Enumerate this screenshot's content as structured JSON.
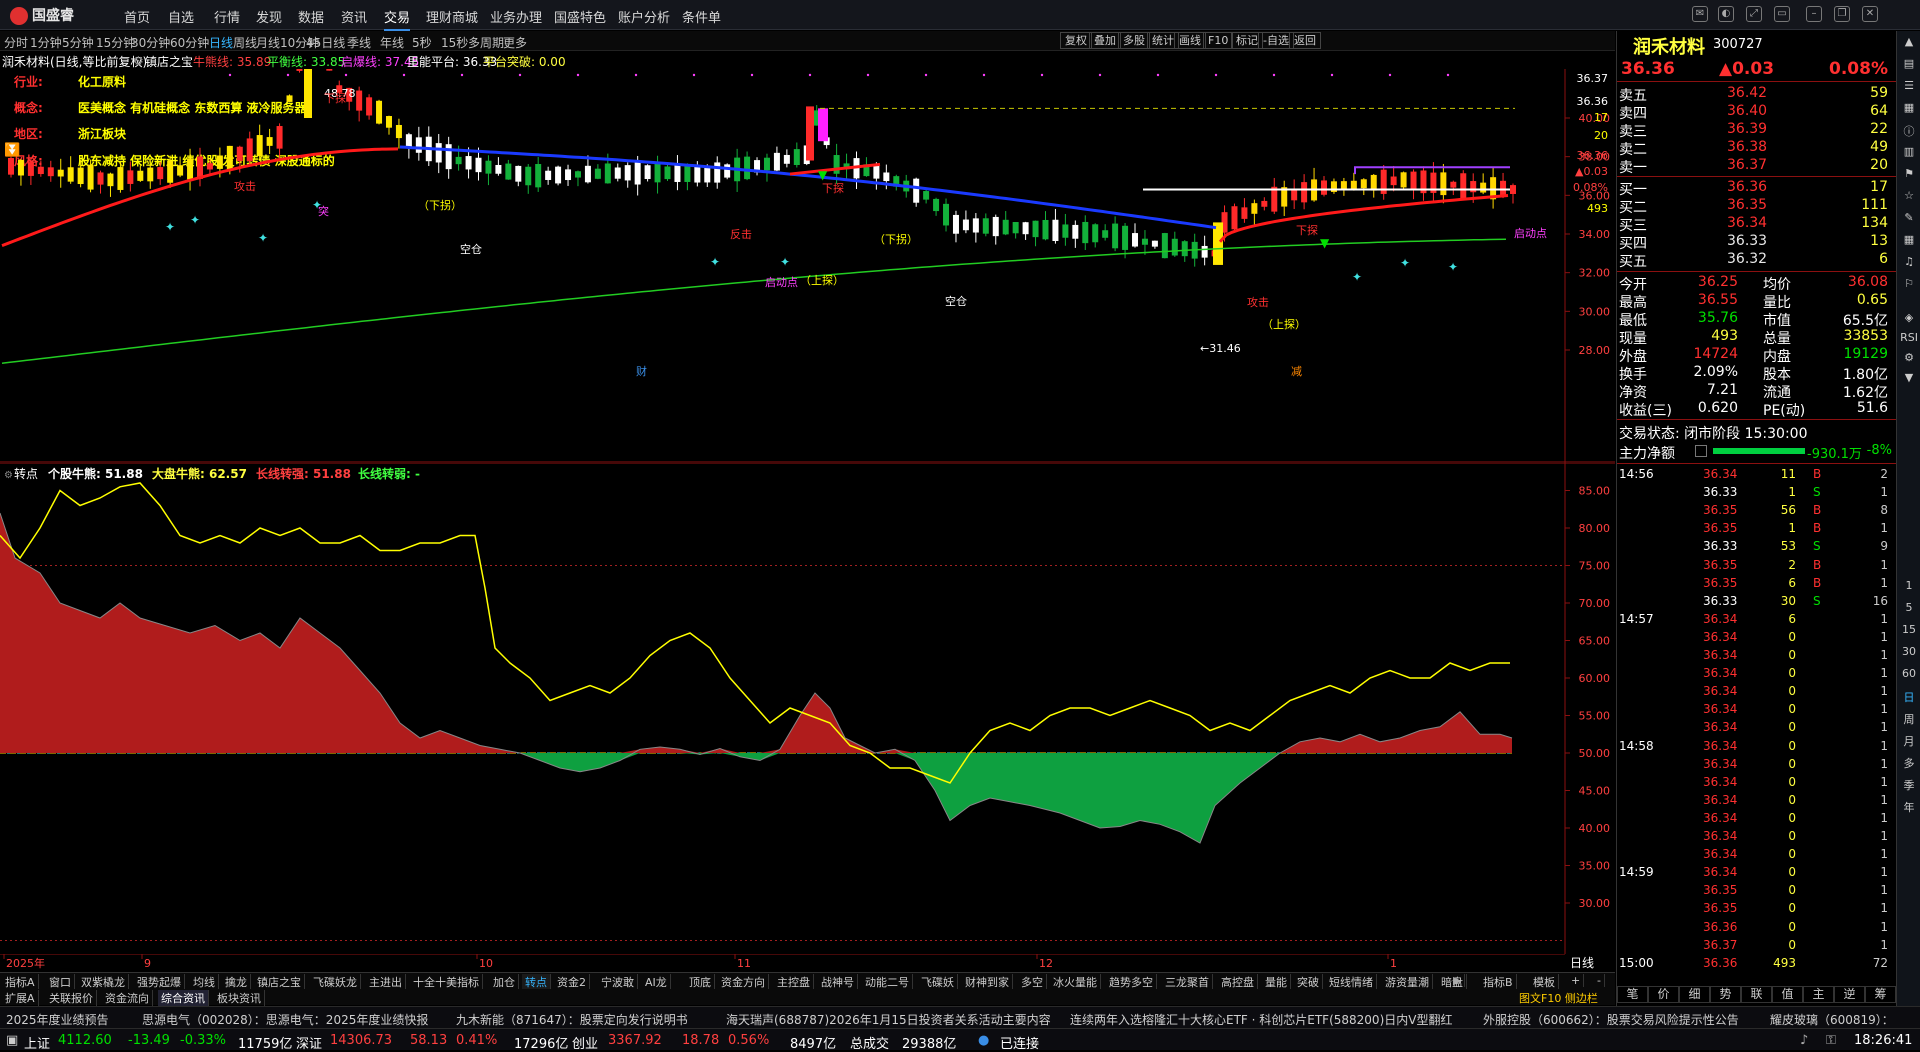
{
  "app": {
    "title": "国盛睿"
  },
  "nav": [
    "首页",
    "自选",
    "行情",
    "发现",
    "数据",
    "资讯",
    "交易",
    "理财商城",
    "业务办理",
    "国盛特色",
    "账户分析",
    "条件单"
  ],
  "nav_active": "交易",
  "periods": [
    "分时",
    "1分钟",
    "5分钟",
    "15分钟",
    "30分钟",
    "60分钟",
    "日线",
    "周线",
    "月线",
    "10分钟",
    "45日线",
    "季线",
    "年线",
    "5秒",
    "15秒",
    "多周期",
    "更多"
  ],
  "period_active": "日线",
  "toolbar": [
    "复权",
    "叠加",
    "多股",
    "统计",
    "画线",
    "F10",
    "标记",
    "-自选",
    "返回"
  ],
  "info": {
    "stock": "润禾材料(日线,等比前复权)",
    "indicator": "镇店之宝",
    "items": [
      {
        "label": "牛熊线: 35.89",
        "color": "#ff4040"
      },
      {
        "label": "平衡线: 33.85",
        "color": "#40ff40"
      },
      {
        "label": "启爆线: 37.45",
        "color": "#ff40ff"
      },
      {
        "label": "里能平台: 36.33",
        "color": "#ffffff"
      },
      {
        "label": "平台突破: 0.00",
        "color": "#ffff40"
      }
    ]
  },
  "concepts": [
    {
      "key": "行业:",
      "val": "化工原料"
    },
    {
      "key": "概念:",
      "val": "医美概念 有机硅概念 东数西算 液冷服务器"
    },
    {
      "key": "地区:",
      "val": "浙江板块"
    },
    {
      "key": "风格:",
      "val": "股东减持 保险新进 绩优股 发可转债 深股通标的"
    }
  ],
  "chart_marks": {
    "high_label": "48.78",
    "low_label": "←31.46",
    "xia_tan": "下探",
    "shang_tan": "上探",
    "xia_guai": "（下拐）",
    "shang_tan2": "（上探）",
    "kong_cang": "空仓",
    "gong_ji": "攻击",
    "qi_dong": "启动点",
    "fan_ji": "反击",
    "cai": "财",
    "jian": "减",
    "tu": "突"
  },
  "main_yaxis": [
    "40.00",
    "38.00",
    "36.00",
    "34.00",
    "32.00",
    "30.00",
    "28.00"
  ],
  "main_right_labels": [
    "36.37",
    "36.36",
    "17",
    "36.36",
    "▲0.03",
    "0.08%",
    "493",
    "20"
  ],
  "sub_info": {
    "name": "转点",
    "items": [
      {
        "label": "个股牛熊: 51.88",
        "color": "#ffffff"
      },
      {
        "label": "大盘牛熊: 62.57",
        "color": "#ffff40"
      },
      {
        "label": "长线转强: 51.88",
        "color": "#ff4040"
      },
      {
        "label": "长线转弱: -",
        "color": "#40ff40"
      }
    ]
  },
  "sub_yaxis": [
    "85.00",
    "80.00",
    "75.00",
    "70.00",
    "65.00",
    "60.00",
    "55.00",
    "50.00",
    "45.00",
    "40.00",
    "35.00",
    "30.00"
  ],
  "xaxis": [
    "2025年",
    "9",
    "10",
    "11",
    "12",
    "1"
  ],
  "xaxis_right": "日线",
  "indicator_tabs": [
    "指标A",
    "窗口",
    "双紫橇龙",
    "强势起爆",
    "均线",
    "擒龙",
    "镇店之宝",
    "飞碟妖龙",
    "主进出",
    "十全十美指标",
    "加仓",
    "转点",
    "资金2",
    "宁波敢",
    "AI龙",
    "顶底",
    "资金方向",
    "主控盘",
    "战神号",
    "动能二号",
    "飞碟妖",
    "财神到家",
    "多空",
    "冰火量能",
    "趋势多空",
    "三龙聚首",
    "高控盘",
    "量能",
    "突破",
    "短线情绪",
    "游资量潮",
    "暗盘"
  ],
  "indicator_active": "转点",
  "indicator_right": [
    "指标B",
    "模板",
    "+",
    "-"
  ],
  "tabs2": [
    "扩展A",
    "关联报价",
    "资金流向",
    "综合资讯",
    "板块资讯"
  ],
  "tabs2_active": "综合资讯",
  "tabs2_right": "图文F10 侧边栏 ≪",
  "news": [
    "2025年度业绩预告",
    "思源电气（002028）：思源电气：2025年度业绩快报",
    "九木新能（871647）：股票定向发行说明书",
    "海天瑞声(688787)2026年1月15日投资者关系活动主要内容",
    "连续两年入选榕隆汇十大核心ETF · 科创芯片ETF(588200)日内V型翻红",
    "外服控股（600662）：股票交易风险提示性公告",
    "耀皮玻璃（600819）："
  ],
  "status": {
    "sh": "上证",
    "sh_val": "4112.60",
    "sh_chg": "-13.49",
    "sh_pct": "-0.33%",
    "sh_amt": "11759亿",
    "sz": "深证",
    "sz_val": "14306.73",
    "sz_chg": "58.13",
    "sz_pct": "0.41%",
    "sz_amt": "17296亿",
    "cy": "创业",
    "cy_val": "3367.92",
    "cy_chg": "18.78",
    "cy_pct": "0.56%",
    "cy_amt": "8497亿",
    "total_label": "总成交",
    "total": "29388亿",
    "conn": "已连接",
    "time": "18:26:41"
  },
  "quote": {
    "name": "润禾材料",
    "code": "300727",
    "price": "36.36",
    "chg": "▲0.03",
    "pct": "0.08%",
    "asks": [
      {
        "l": "卖五",
        "p": "36.42",
        "v": "59"
      },
      {
        "l": "卖四",
        "p": "36.40",
        "v": "64"
      },
      {
        "l": "卖三",
        "p": "36.39",
        "v": "22"
      },
      {
        "l": "卖二",
        "p": "36.38",
        "v": "49"
      },
      {
        "l": "卖一",
        "p": "36.37",
        "v": "20"
      }
    ],
    "bids": [
      {
        "l": "买一",
        "p": "36.36",
        "v": "17"
      },
      {
        "l": "买二",
        "p": "36.35",
        "v": "111"
      },
      {
        "l": "买三",
        "p": "36.34",
        "v": "134"
      },
      {
        "l": "买四",
        "p": "36.33",
        "v": "13"
      },
      {
        "l": "买五",
        "p": "36.32",
        "v": "6"
      }
    ],
    "stats": [
      [
        "今开",
        "36.25",
        "均价",
        "36.08"
      ],
      [
        "最高",
        "36.55",
        "量比",
        "0.65"
      ],
      [
        "最低",
        "35.76",
        "市值",
        "65.5亿"
      ],
      [
        "现量",
        "493",
        "总量",
        "33853"
      ],
      [
        "外盘",
        "14724",
        "内盘",
        "19129"
      ],
      [
        "换手",
        "2.09%",
        "股本",
        "1.80亿"
      ],
      [
        "净资",
        "7.21",
        "流通",
        "1.62亿"
      ],
      [
        "收益(三)",
        "0.620",
        "PE(动)",
        "51.6"
      ]
    ],
    "trade_status": "交易状态: 闭市阶段 15:30:00",
    "main_net_label": "主力净额",
    "main_net": "-930.1万",
    "main_net_pct": "-8%"
  },
  "ticks": [
    {
      "t": "14:56",
      "p": "36.34",
      "v": "11",
      "d": "B",
      "n": "2"
    },
    {
      "t": "",
      "p": "36.33",
      "v": "1",
      "d": "S",
      "n": "1"
    },
    {
      "t": "",
      "p": "36.35",
      "v": "56",
      "d": "B",
      "n": "8"
    },
    {
      "t": "",
      "p": "36.35",
      "v": "1",
      "d": "B",
      "n": "1"
    },
    {
      "t": "",
      "p": "36.33",
      "v": "53",
      "d": "S",
      "n": "9"
    },
    {
      "t": "",
      "p": "36.35",
      "v": "2",
      "d": "B",
      "n": "1"
    },
    {
      "t": "",
      "p": "36.35",
      "v": "6",
      "d": "B",
      "n": "1"
    },
    {
      "t": "",
      "p": "36.33",
      "v": "30",
      "d": "S",
      "n": "16"
    },
    {
      "t": "14:57",
      "p": "36.34",
      "v": "6",
      "d": "",
      "n": "1"
    },
    {
      "t": "",
      "p": "36.34",
      "v": "0",
      "d": "",
      "n": "1"
    },
    {
      "t": "",
      "p": "36.34",
      "v": "0",
      "d": "",
      "n": "1"
    },
    {
      "t": "",
      "p": "36.34",
      "v": "0",
      "d": "",
      "n": "1"
    },
    {
      "t": "",
      "p": "36.34",
      "v": "0",
      "d": "",
      "n": "1"
    },
    {
      "t": "",
      "p": "36.34",
      "v": "0",
      "d": "",
      "n": "1"
    },
    {
      "t": "",
      "p": "36.34",
      "v": "0",
      "d": "",
      "n": "1"
    },
    {
      "t": "14:58",
      "p": "36.34",
      "v": "0",
      "d": "",
      "n": "1"
    },
    {
      "t": "",
      "p": "36.34",
      "v": "0",
      "d": "",
      "n": "1"
    },
    {
      "t": "",
      "p": "36.34",
      "v": "0",
      "d": "",
      "n": "1"
    },
    {
      "t": "",
      "p": "36.34",
      "v": "0",
      "d": "",
      "n": "1"
    },
    {
      "t": "",
      "p": "36.34",
      "v": "0",
      "d": "",
      "n": "1"
    },
    {
      "t": "",
      "p": "36.34",
      "v": "0",
      "d": "",
      "n": "1"
    },
    {
      "t": "",
      "p": "36.34",
      "v": "0",
      "d": "",
      "n": "1"
    },
    {
      "t": "14:59",
      "p": "36.34",
      "v": "0",
      "d": "",
      "n": "1"
    },
    {
      "t": "",
      "p": "36.35",
      "v": "0",
      "d": "",
      "n": "1"
    },
    {
      "t": "",
      "p": "36.35",
      "v": "0",
      "d": "",
      "n": "1"
    },
    {
      "t": "",
      "p": "36.36",
      "v": "0",
      "d": "",
      "n": "1"
    },
    {
      "t": "",
      "p": "36.37",
      "v": "0",
      "d": "",
      "n": "1"
    },
    {
      "t": "15:00",
      "p": "36.36",
      "v": "493",
      "d": "",
      "n": "72"
    }
  ],
  "bottom_tabs": [
    "笔",
    "价",
    "细",
    "势",
    "联",
    "值",
    "主",
    "逆",
    "筹"
  ],
  "side_icons": [
    "1",
    "5",
    "15",
    "30",
    "60",
    "日",
    "周",
    "月",
    "多",
    "季",
    "年"
  ],
  "colors": {
    "up": "#ff3030",
    "down": "#00c040",
    "ma_red": "#ff1a1a",
    "ma_blue": "#1a3aff",
    "ma_green": "#22cc22",
    "yellow": "#ffff00"
  }
}
